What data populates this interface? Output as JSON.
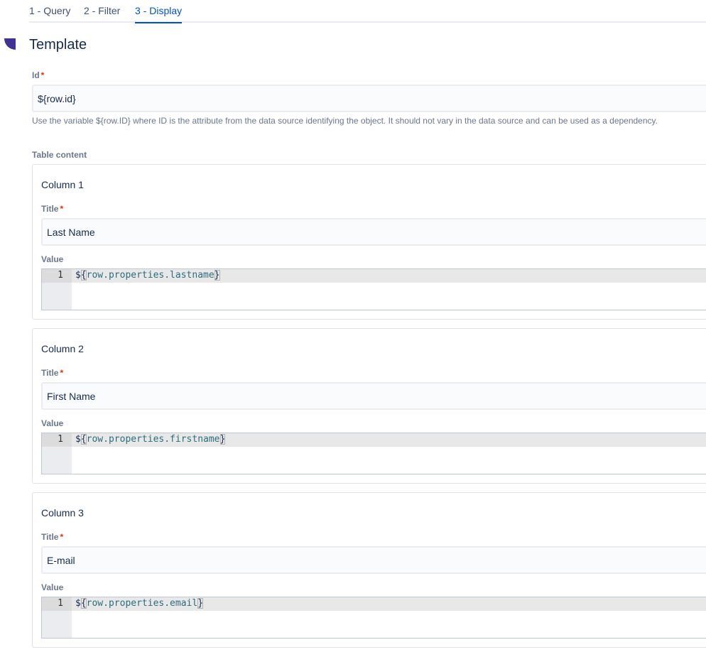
{
  "tabs": [
    {
      "label": "1 - Query",
      "active": false
    },
    {
      "label": "2 - Filter",
      "active": false
    },
    {
      "label": "3 - Display",
      "active": true
    }
  ],
  "section": {
    "title": "Template"
  },
  "id_field": {
    "label": "Id",
    "required_mark": "*",
    "value": "${row.id}",
    "help": "Use the variable ${row.ID} where ID is the attribute from the data source identifying the object. It should not vary in the data source and can be used as a dependency."
  },
  "table_content": {
    "label": "Table content",
    "columns": [
      {
        "heading": "Column 1",
        "title_label": "Title",
        "required_mark": "*",
        "title_value": "Last Name",
        "value_label": "Value",
        "line_number": "1",
        "code_prefix": "$",
        "code_open": "{",
        "code_expr": "row.properties.lastname",
        "code_close": "}"
      },
      {
        "heading": "Column 2",
        "title_label": "Title",
        "required_mark": "*",
        "title_value": "First Name",
        "value_label": "Value",
        "line_number": "1",
        "code_prefix": "$",
        "code_open": "{",
        "code_expr": "row.properties.firstname",
        "code_close": "}"
      },
      {
        "heading": "Column 3",
        "title_label": "Title",
        "required_mark": "*",
        "title_value": "E-mail",
        "value_label": "Value",
        "line_number": "1",
        "code_prefix": "$",
        "code_open": "{",
        "code_expr": "row.properties.email",
        "code_close": "}"
      }
    ]
  },
  "colors": {
    "active_tab": "#0052cc",
    "required": "#de350b",
    "collapse_marker": "#403294"
  },
  "icons": {
    "collapse_marker": "quarter-circle-collapse-icon"
  }
}
